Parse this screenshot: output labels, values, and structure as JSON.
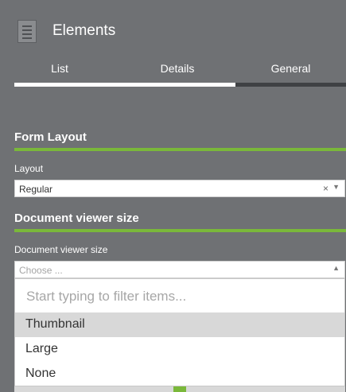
{
  "header": {
    "title": "Elements",
    "icon": "document-list-icon",
    "tabs": [
      {
        "label": "List"
      },
      {
        "label": "Details"
      },
      {
        "label": "General"
      }
    ],
    "active_tab": "General"
  },
  "form": {
    "sections": [
      {
        "title": "Form Layout"
      },
      {
        "title": "Document viewer size"
      }
    ],
    "layout_label": "Layout",
    "layout_value": "Regular",
    "clear_glyph": "×",
    "caret_down": "▼",
    "caret_up": "▲",
    "viewer_label": "Document viewer size",
    "viewer_placeholder": "Choose ..."
  },
  "dropdown": {
    "filter_placeholder": "Start typing to filter items...",
    "options": [
      {
        "label": "Thumbnail",
        "highlighted": true
      },
      {
        "label": "Large",
        "highlighted": false
      },
      {
        "label": "None",
        "highlighted": false
      }
    ]
  },
  "colors": {
    "accent": "#7ab83a",
    "panel": "#6f7174",
    "active_tab_bar": "#ffffff",
    "inactive_tab_bar": "#3f4144"
  }
}
